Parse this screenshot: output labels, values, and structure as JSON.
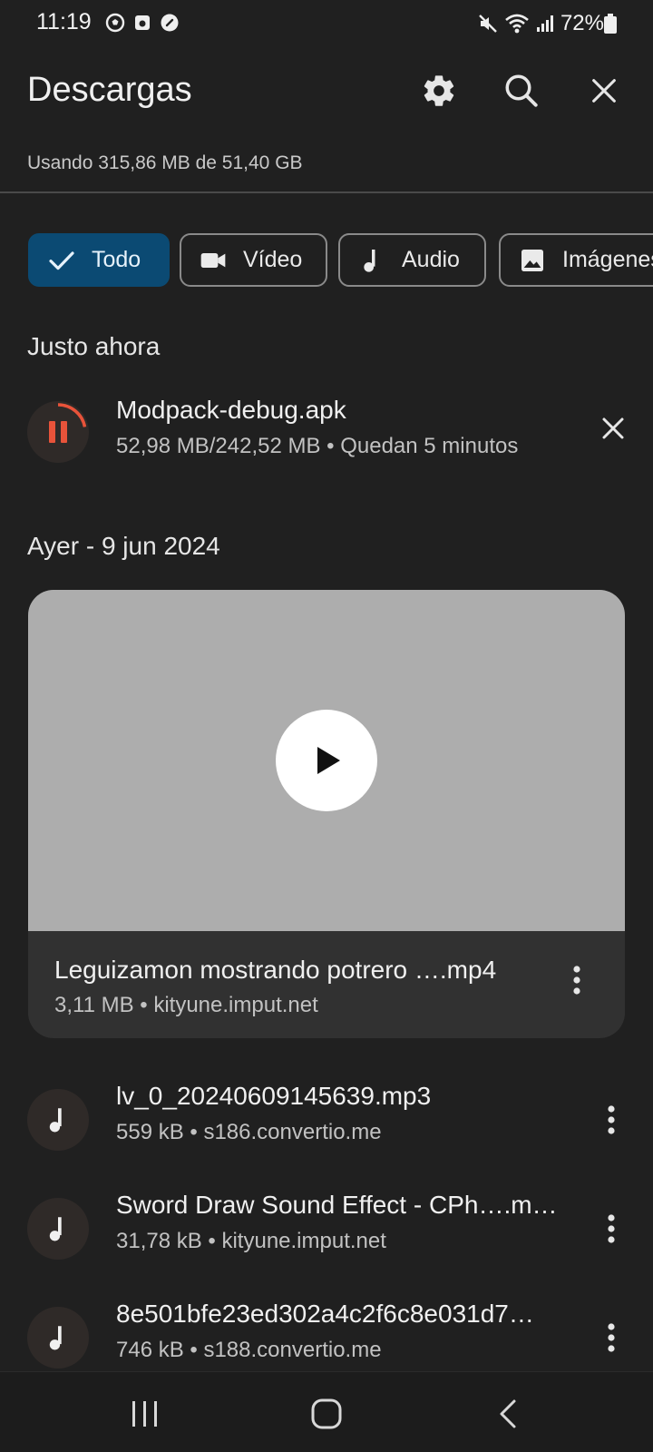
{
  "status_bar": {
    "time": "11:19",
    "battery": "72%"
  },
  "header": {
    "title": "Descargas",
    "icons": [
      "gear-icon",
      "search-icon",
      "close-icon"
    ]
  },
  "storage_text": "Usando 315,86 MB de 51,40 GB",
  "filters": [
    {
      "label": "Todo",
      "icon": "check-icon",
      "active": true
    },
    {
      "label": "Vídeo",
      "icon": "video-camera-icon",
      "active": false
    },
    {
      "label": "Audio",
      "icon": "music-note-icon",
      "active": false
    },
    {
      "label": "Imágenes",
      "icon": "image-icon",
      "active": false
    }
  ],
  "sections": {
    "now": "Justo ahora",
    "yesterday": "Ayer - 9 jun 2024"
  },
  "active_download": {
    "name": "Modpack-debug.apk",
    "details": "52,98 MB/242,52 MB • Quedan 5 minutos",
    "progress_fraction": 0.22,
    "accent_color": "#e8533a"
  },
  "video_item": {
    "name": "Leguizamon mostrando potrero ….mp4",
    "details": "3,11 MB • kityune.imput.net"
  },
  "files": [
    {
      "name": "lv_0_20240609145639.mp3",
      "details": "559 kB • s186.convertio.me"
    },
    {
      "name": "Sword Draw Sound Effect - CPh….m…",
      "details": "31,78 kB • kityune.imput.net"
    },
    {
      "name": "8e501bfe23ed302a4c2f6c8e031d7…",
      "details": "746 kB • s188.convertio.me"
    }
  ]
}
